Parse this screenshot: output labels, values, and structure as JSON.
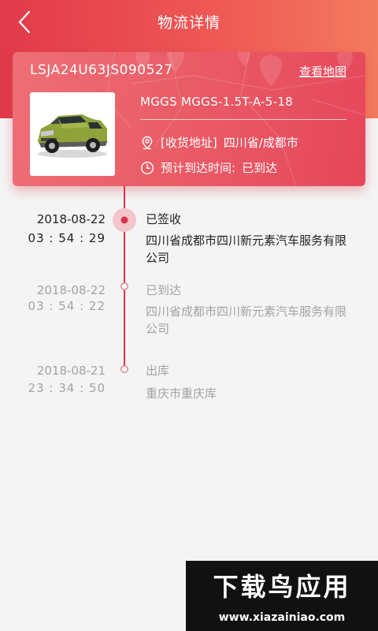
{
  "header": {
    "title": "物流详情",
    "back_icon": "back-arrow-icon"
  },
  "vehicle": {
    "vin": "LSJA24U63JS090527",
    "map_link": "查看地图",
    "model": "MGGS MGGS-1.5T-A-5-18",
    "address_label": "[收货地址]",
    "address_value": "四川省/成都市",
    "eta_label": "预计到达时间:",
    "eta_value": "已到达"
  },
  "timeline": [
    {
      "date": "2018-08-22",
      "time": "03 : 54 : 29",
      "status": "已签收",
      "location": "四川省成都市四川新元素汽车服务有限公司",
      "state": "active"
    },
    {
      "date": "2018-08-22",
      "time": "03 : 54 : 22",
      "status": "已到达",
      "location": "四川省成都市四川新元素汽车服务有限公司",
      "state": "past"
    },
    {
      "date": "2018-08-21",
      "time": "23 : 34 : 50",
      "status": "出库",
      "location": "重庆市重庆库",
      "state": "past"
    }
  ],
  "watermark": {
    "title": "下载鸟应用",
    "url": "www.xiazainiao.com"
  },
  "colors": {
    "accent": "#e23a4b",
    "accent_light": "#f37b5e",
    "text_active": "#222222",
    "text_muted": "#a3a3a3"
  }
}
